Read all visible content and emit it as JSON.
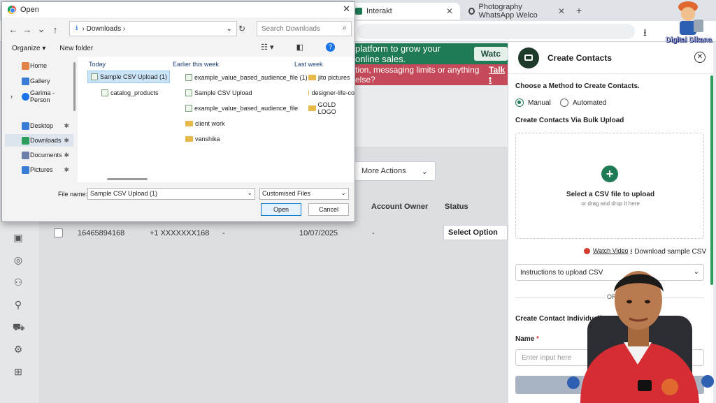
{
  "browser": {
    "tabs": [
      {
        "label": "Interakt",
        "active": true
      },
      {
        "label": "Photography WhatsApp Welco",
        "active": false
      }
    ],
    "new_tab_label": "+"
  },
  "branding": {
    "text": "Digital Dikana"
  },
  "app": {
    "promo_text": "platform to grow your online sales.",
    "promo_button": "Watc",
    "warning_text": "tion, messaging limits or anything else?",
    "warning_link": "Talk t",
    "actions_label": "More Actions",
    "table": {
      "headers": [
        "Account Owner",
        "Status"
      ],
      "row": {
        "phone": "16465894168",
        "masked": "+1 XXXXXXX168",
        "dash1": "-",
        "date": "10/07/2025",
        "dash2": "-",
        "status": "Select Option"
      }
    }
  },
  "dialog": {
    "title": "Open",
    "path_segments": [
      "Downloads"
    ],
    "search_placeholder": "Search Downloads",
    "toolbar": {
      "organize": "Organize ▾",
      "new_folder": "New folder"
    },
    "sidebar": [
      {
        "label": "Home",
        "color": "#e0834a"
      },
      {
        "label": "Gallery",
        "color": "#3a7bd5"
      },
      {
        "label": "Garima - Person",
        "color": "#1a73e8"
      },
      {
        "label": "Desktop",
        "color": "#3a7bd5"
      },
      {
        "label": "Downloads",
        "color": "#2e9d5b"
      },
      {
        "label": "Documents",
        "color": "#6b7fa8"
      },
      {
        "label": "Pictures",
        "color": "#3a7bd5"
      }
    ],
    "groups": {
      "today": "Today",
      "earlier": "Earlier this week",
      "last_week": "Last week"
    },
    "files_today": [
      "Sample CSV Upload (1)",
      "catalog_products"
    ],
    "files_earlier": [
      "example_value_based_audience_file (1)",
      "Sample CSV Upload",
      "example_value_based_audience_file",
      "client work",
      "vanshika"
    ],
    "files_last_week": [
      "jito pictures",
      "designer-life-co",
      "GOLD LOGO"
    ],
    "file_name_label": "File name:",
    "file_name_value": "Sample CSV Upload (1)",
    "filter": "Customised Files",
    "open": "Open",
    "cancel": "Cancel"
  },
  "panel": {
    "title": "Create Contacts",
    "method_label": "Choose a Method to Create Contacts.",
    "manual": "Manual",
    "automated": "Automated",
    "bulk_label": "Create Contacts Via Bulk Upload",
    "dz_title": "Select a CSV file to upload",
    "dz_sub": "or drag and drop it here",
    "watch_video": "Watch Video",
    "download_sample": "Download sample CSV",
    "instructions": "Instructions to upload CSV",
    "or": "OR",
    "individual_label": "Create Contact Individually",
    "name_label": "Name",
    "name_required": "*",
    "name_placeholder": "Enter input here"
  },
  "colors": {
    "brand_green": "#1f7a55",
    "warning_red": "#c44a59"
  }
}
